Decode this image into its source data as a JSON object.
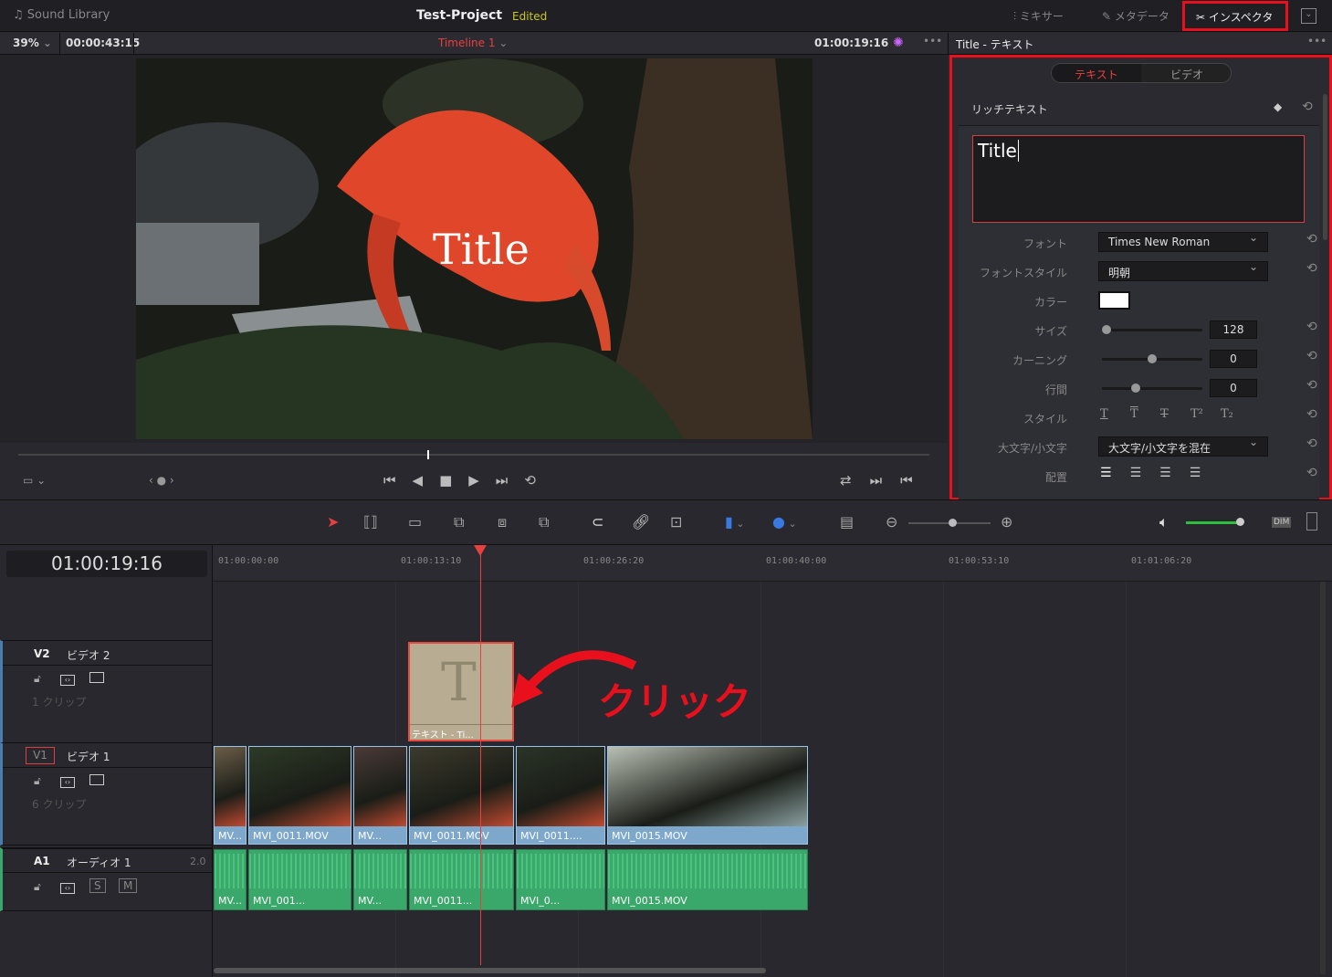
{
  "topbar": {
    "sound_library": "Sound Library",
    "project": "Test-Project",
    "status": "Edited",
    "mixer": "ミキサー",
    "metadata": "メタデータ",
    "inspector": "インスペクタ"
  },
  "viewerbar": {
    "zoom": "39%",
    "duration": "00:00:43:15",
    "timeline": "Timeline 1",
    "timecode": "01:00:19:16",
    "inspector_title": "Title - テキスト"
  },
  "viewer": {
    "overlay_title": "Title"
  },
  "inspector": {
    "tabs": [
      {
        "label": "テキスト",
        "active": true
      },
      {
        "label": "ビデオ",
        "active": false
      }
    ],
    "section": "リッチテキスト",
    "text_value": "Title",
    "font_label": "フォント",
    "font_value": "Times New Roman",
    "font_style_label": "フォントスタイル",
    "font_style_value": "明朝",
    "color_label": "カラー",
    "color_value": "#ffffff",
    "size_label": "サイズ",
    "size_value": "128",
    "kerning_label": "カーニング",
    "kerning_value": "0",
    "line_spacing_label": "行間",
    "line_spacing_value": "0",
    "style_label": "スタイル",
    "style_buttons": [
      "T",
      "T",
      "T",
      "T²",
      "T₂"
    ],
    "case_label": "大文字/小文字",
    "case_value": "大文字/小文字を混在",
    "align_label": "配置"
  },
  "timeline": {
    "timecode": "01:00:19:16",
    "ruler": [
      "01:00:00:00",
      "01:00:13:10",
      "01:00:26:20",
      "01:00:40:00",
      "01:00:53:10",
      "01:01:06:20"
    ],
    "tracks": {
      "v2": {
        "id": "V2",
        "name": "ビデオ 2",
        "count": "1 クリップ"
      },
      "v1": {
        "id": "V1",
        "name": "ビデオ 1",
        "count": "6 クリップ"
      },
      "a1": {
        "id": "A1",
        "name": "オーディオ 1",
        "channels": "2.0",
        "solo": "S",
        "mute": "M"
      }
    },
    "title_clip": "テキスト - Ti...",
    "video_clips": [
      "MV...",
      "MVI_0011.MOV",
      "MV...",
      "MVI_0011.MOV",
      "MVI_0011....",
      "MVI_0015.MOV"
    ],
    "audio_clips": [
      "MV...",
      "MVI_001...",
      "MV...",
      "MVI_0011...",
      "MVI_0...",
      "MVI_0015.MOV"
    ],
    "annotation": "クリック",
    "dim": "DIM"
  },
  "colors": {
    "accent": "#e8101c",
    "clip_video": "#7ea7cc",
    "clip_audio": "#3aa86a",
    "title_clip": "#b8ad92"
  }
}
